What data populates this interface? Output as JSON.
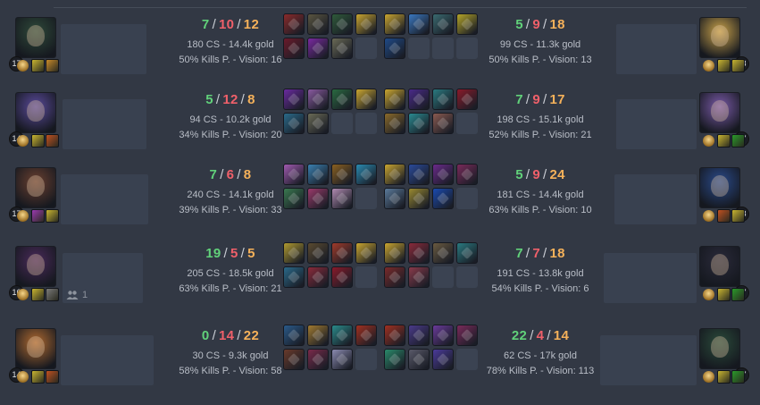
{
  "rows": [
    {
      "left": {
        "level": "17",
        "kda": {
          "k": "7",
          "d": "10",
          "a": "12"
        },
        "stats": "180 CS - 14.4k gold",
        "kp": "50% Kills P. - Vision: 16",
        "champ_color": "#2f4a3a",
        "spell_colors": [
          "#c9b531",
          "#c78a2a"
        ],
        "items": [
          "#8a2a2a",
          "#5a5540",
          "#2f5a3a",
          "#c9a530",
          "#6b1a2a",
          "#7a2aa0",
          "#6a6a55",
          ""
        ]
      },
      "right": {
        "level": "18",
        "kda": {
          "k": "5",
          "d": "9",
          "a": "18"
        },
        "stats": "99 CS - 11.3k gold",
        "kp": "50% Kills P. - Vision: 13",
        "champ_color": "#c9a24a",
        "spell_colors": [
          "#c9b531",
          "#c9b531"
        ],
        "items": [
          "#c9a530",
          "#3a78c0",
          "#3a6a70",
          "#b5a528",
          "#1f4a88",
          "",
          "",
          ""
        ]
      }
    },
    {
      "left": {
        "level": "14",
        "kda": {
          "k": "5",
          "d": "12",
          "a": "8"
        },
        "stats": "94 CS - 10.2k gold",
        "kp": "34% Kills P. - Vision: 20",
        "champ_color": "#5a4a9a",
        "spell_colors": [
          "#c9b531",
          "#c05020"
        ],
        "items": [
          "#6a2aa0",
          "#8a5aa0",
          "#2a6a40",
          "#c9a530",
          "#2a6a8a",
          "#6a6a55",
          "",
          ""
        ]
      },
      "right": {
        "level": "17",
        "kda": {
          "k": "7",
          "d": "9",
          "a": "17"
        },
        "stats": "198 CS - 15.1k gold",
        "kp": "52% Kills P. - Vision: 21",
        "champ_color": "#7a5aa8",
        "spell_colors": [
          "#c9b531",
          "#2a9a2a"
        ],
        "items": [
          "#c9a530",
          "#4a2a8a",
          "#2a7a80",
          "#8a1a2a",
          "#8a6a2a",
          "#2a8a90",
          "#8a5a50",
          ""
        ]
      }
    },
    {
      "left": {
        "level": "17",
        "kda": {
          "k": "7",
          "d": "6",
          "a": "8"
        },
        "stats": "240 CS - 14.1k gold",
        "kp": "39% Kills P. - Vision: 33",
        "champ_color": "#6a4030",
        "spell_colors": [
          "#9a3ab0",
          "#c9b531"
        ],
        "items": [
          "#a05ab0",
          "#3a80b0",
          "#8a6020",
          "#2a8ab0",
          "#3a7a50",
          "#9a3a6a",
          "#b08ab0",
          ""
        ]
      },
      "right": {
        "level": "18",
        "kda": {
          "k": "5",
          "d": "9",
          "a": "24"
        },
        "stats": "181 CS - 14.4k gold",
        "kp": "63% Kills P. - Vision: 10",
        "champ_color": "#2a4a8a",
        "spell_colors": [
          "#c05020",
          "#c9b531"
        ],
        "items": [
          "#c9a530",
          "#2a4a9a",
          "#6a2a8a",
          "#7a2a5a",
          "#5a7a9a",
          "#9a8a30",
          "#1a4ab0",
          ""
        ]
      }
    },
    {
      "left": {
        "level": "16",
        "kda": {
          "k": "19",
          "d": "5",
          "a": "5"
        },
        "stats": "205 CS - 18.5k gold",
        "kp": "63% Kills P. - Vision: 21",
        "champ_color": "#4a2a5a",
        "spell_colors": [
          "#c9b531",
          "#7a7a7a"
        ],
        "party": "1",
        "items": [
          "#b09a30",
          "#5a4a30",
          "#a03a2a",
          "#c9a530",
          "#2a6a8a",
          "#8a2a3a",
          "#8a1a2a",
          ""
        ]
      },
      "right": {
        "level": "17",
        "kda": {
          "k": "7",
          "d": "7",
          "a": "18"
        },
        "stats": "191 CS - 13.8k gold",
        "kp": "54% Kills P. - Vision: 6",
        "champ_color": "#2a2a3a",
        "spell_colors": [
          "#c9b531",
          "#2a9a2a"
        ],
        "items": [
          "#c9a530",
          "#8a2a3a",
          "#6a5a40",
          "#2a7a80",
          "#7a2a2a",
          "#8a3a4a",
          "",
          ""
        ]
      }
    },
    {
      "left": {
        "level": "14",
        "kda": {
          "k": "0",
          "d": "14",
          "a": "22"
        },
        "stats": "30 CS - 9.3k gold",
        "kp": "58% Kills P. - Vision: 58",
        "champ_color": "#b06a30",
        "spell_colors": [
          "#c9b531",
          "#c05020"
        ],
        "items": [
          "#2a5a8a",
          "#a07a30",
          "#2a8a8a",
          "#a03020",
          "#6a3a2a",
          "#7a2a4a",
          "#8a8ab0",
          ""
        ]
      },
      "right": {
        "level": "17",
        "kda": {
          "k": "22",
          "d": "4",
          "a": "14"
        },
        "stats": "62 CS - 17k gold",
        "kp": "78% Kills P. - Vision: 113",
        "champ_color": "#2a4a3a",
        "spell_colors": [
          "#c9b531",
          "#2a9a2a"
        ],
        "items": [
          "#a03020",
          "#4a3a8a",
          "#6a3a9a",
          "#7a2a5a",
          "#2a8a6a",
          "#5a5a6a",
          "#4a3a9a",
          ""
        ]
      }
    }
  ]
}
